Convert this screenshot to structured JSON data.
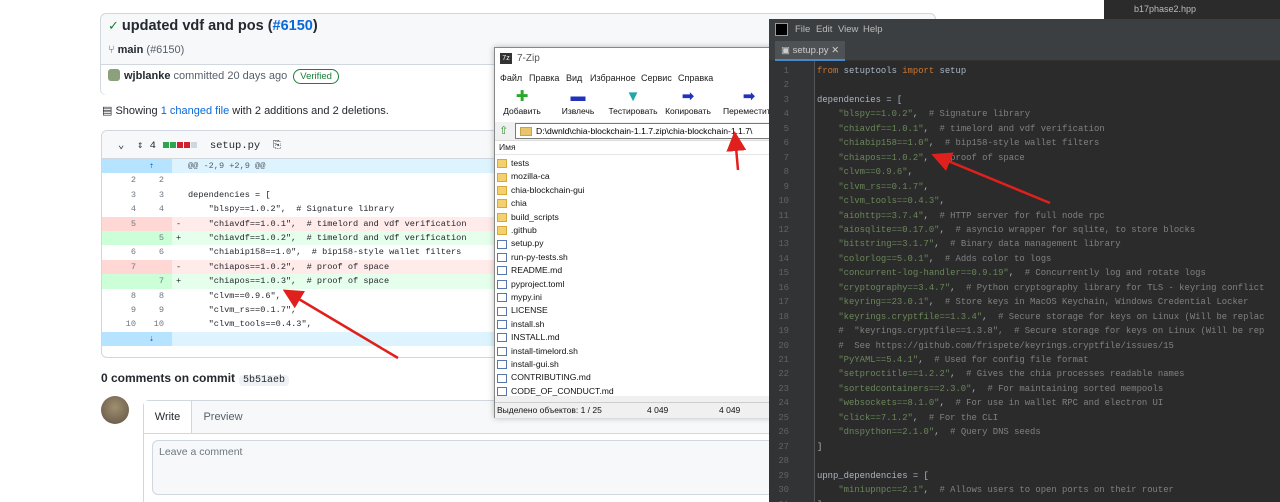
{
  "github": {
    "commit_title": "updated vdf and pos (",
    "commit_pr": "#6150",
    "commit_close": ")",
    "branch": "main",
    "branch_pr": "(#6150)",
    "author": "wjblanke",
    "committed": "committed 20 days ago",
    "verified": "Verified",
    "showing_pre": "Showing ",
    "showing_link": "1 changed file",
    "showing_post": " with 2 additions and 2 deletions.",
    "file_changes": "4",
    "file_name": "setup.py",
    "hunk": "@@ -2,9 +2,9 @@",
    "diff_rows": [
      {
        "type": "hunk",
        "old": "",
        "new": "",
        "sign": "",
        "code": "@@ -2,9 +2,9 @@"
      },
      {
        "type": "ctx",
        "old": "2",
        "new": "2",
        "sign": "",
        "code": ""
      },
      {
        "type": "ctx",
        "old": "3",
        "new": "3",
        "sign": "",
        "code": "dependencies = ["
      },
      {
        "type": "ctx",
        "old": "4",
        "new": "4",
        "sign": "",
        "code": "    \"blspy==1.0.2\",  # Signature library"
      },
      {
        "type": "del",
        "old": "5",
        "new": "",
        "sign": "-",
        "code": "    \"chiavdf==1.0.1\",  # timelord and vdf verification"
      },
      {
        "type": "add",
        "old": "",
        "new": "5",
        "sign": "+",
        "code": "    \"chiavdf==1.0.2\",  # timelord and vdf verification"
      },
      {
        "type": "ctx",
        "old": "6",
        "new": "6",
        "sign": "",
        "code": "    \"chiabip158==1.0\",  # bip158-style wallet filters"
      },
      {
        "type": "del",
        "old": "7",
        "new": "",
        "sign": "-",
        "code": "    \"chiapos==1.0.2\",  # proof of space"
      },
      {
        "type": "add",
        "old": "",
        "new": "7",
        "sign": "+",
        "code": "    \"chiapos==1.0.3\",  # proof of space"
      },
      {
        "type": "ctx",
        "old": "8",
        "new": "8",
        "sign": "",
        "code": "    \"clvm==0.9.6\","
      },
      {
        "type": "ctx",
        "old": "9",
        "new": "9",
        "sign": "",
        "code": "    \"clvm_rs==0.1.7\","
      },
      {
        "type": "ctx",
        "old": "10",
        "new": "10",
        "sign": "",
        "code": "    \"clvm_tools==0.4.3\","
      },
      {
        "type": "hunk",
        "old": "",
        "new": "",
        "sign": "",
        "code": ""
      }
    ],
    "comments": "0 comments on commit",
    "comments_sha": "5b51aeb",
    "tab_write": "Write",
    "tab_preview": "Preview",
    "comment_placeholder": "Leave a comment"
  },
  "zip": {
    "title": "7-Zip",
    "menu": [
      "Файл",
      "Правка",
      "Вид",
      "Избранное",
      "Сервис",
      "Справка"
    ],
    "tools": [
      {
        "label": "Добавить",
        "glyph": "✚",
        "color": "#2aa82a"
      },
      {
        "label": "Извлечь",
        "glyph": "▬",
        "color": "#2233bb"
      },
      {
        "label": "Тестировать",
        "glyph": "▼",
        "color": "#20a8a8"
      },
      {
        "label": "Копировать",
        "glyph": "➡",
        "color": "#2233bb"
      },
      {
        "label": "Переместить",
        "glyph": "➡",
        "color": "#2233bb"
      }
    ],
    "path": "D:\\dwnld\\chia-blockchain-1.1.7.zip\\chia-blockchain-1.1.7\\",
    "column_name": "Имя",
    "items": [
      {
        "name": "tests",
        "kind": "dir"
      },
      {
        "name": "mozilla-ca",
        "kind": "dir"
      },
      {
        "name": "chia-blockchain-gui",
        "kind": "dir"
      },
      {
        "name": "chia",
        "kind": "dir"
      },
      {
        "name": "build_scripts",
        "kind": "dir"
      },
      {
        "name": ".github",
        "kind": "dir"
      },
      {
        "name": "setup.py",
        "kind": "doc"
      },
      {
        "name": "run-py-tests.sh",
        "kind": "doc"
      },
      {
        "name": "README.md",
        "kind": "doc"
      },
      {
        "name": "pyproject.toml",
        "kind": "doc"
      },
      {
        "name": "mypy.ini",
        "kind": "doc"
      },
      {
        "name": "LICENSE",
        "kind": "doc"
      },
      {
        "name": "install.sh",
        "kind": "doc"
      },
      {
        "name": "INSTALL.md",
        "kind": "doc"
      },
      {
        "name": "install-timelord.sh",
        "kind": "doc"
      },
      {
        "name": "install-gui.sh",
        "kind": "doc"
      },
      {
        "name": "CONTRIBUTING.md",
        "kind": "doc"
      },
      {
        "name": "CODE_OF_CONDUCT.md",
        "kind": "doc"
      }
    ],
    "status_selected": "Выделено объектов: 1 / 25",
    "status_size1": "4 049",
    "status_size2": "4 049"
  },
  "ide": {
    "menu": [
      "File",
      "Edit",
      "View",
      "Help"
    ],
    "tab": "setup.py",
    "strip_file": "b17phase2.hpp",
    "lines": [
      {
        "n": "1",
        "html": "<span class='kw'>from</span> setuptools <span class='kw'>import</span> setup"
      },
      {
        "n": "2",
        "html": ""
      },
      {
        "n": "3",
        "html": "dependencies = ["
      },
      {
        "n": "4",
        "html": "    <span class='st'>\"blspy==1.0.2\"</span>,  <span class='cmt'># Signature library</span>"
      },
      {
        "n": "5",
        "html": "    <span class='st'>\"chiavdf==1.0.1\"</span>,  <span class='cmt'># timelord and vdf verification</span>"
      },
      {
        "n": "6",
        "html": "    <span class='st'>\"chiabip158==1.0\"</span>,  <span class='cmt'># bip158-style wallet filters</span>"
      },
      {
        "n": "7",
        "html": "    <span class='st'>\"chiapos==1.0.2\"</span>,  <span class='cmt'># proof of space</span>"
      },
      {
        "n": "8",
        "html": "    <span class='st'>\"clvm==0.9.6\"</span>,"
      },
      {
        "n": "9",
        "html": "    <span class='st'>\"clvm_rs==0.1.7\"</span>,"
      },
      {
        "n": "10",
        "html": "    <span class='st'>\"clvm_tools==0.4.3\"</span>,"
      },
      {
        "n": "11",
        "html": "    <span class='st'>\"aiohttp==3.7.4\"</span>,  <span class='cmt'># HTTP server for full node rpc</span>"
      },
      {
        "n": "12",
        "html": "    <span class='st'>\"aiosqlite==0.17.0\"</span>,  <span class='cmt'># asyncio wrapper for sqlite, to store blocks</span>"
      },
      {
        "n": "13",
        "html": "    <span class='st'>\"bitstring==3.1.7\"</span>,  <span class='cmt'># Binary data management library</span>"
      },
      {
        "n": "14",
        "html": "    <span class='st'>\"colorlog==5.0.1\"</span>,  <span class='cmt'># Adds color to logs</span>"
      },
      {
        "n": "15",
        "html": "    <span class='st'>\"concurrent-log-handler==0.9.19\"</span>,  <span class='cmt'># Concurrently log and rotate logs</span>"
      },
      {
        "n": "16",
        "html": "    <span class='st'>\"cryptography==3.4.7\"</span>,  <span class='cmt'># Python cryptography library for TLS - keyring conflict</span>"
      },
      {
        "n": "17",
        "html": "    <span class='st'>\"keyring==23.0.1\"</span>,  <span class='cmt'># Store keys in MacOS Keychain, Windows Credential Locker</span>"
      },
      {
        "n": "18",
        "html": "    <span class='st'>\"keyrings.cryptfile==1.3.4\"</span>,  <span class='cmt'># Secure storage for keys on Linux (Will be replac</span>"
      },
      {
        "n": "19",
        "html": "    <span class='cmt'>#  \"keyrings.cryptfile==1.3.8\",  # Secure storage for keys on Linux (Will be rep</span>"
      },
      {
        "n": "20",
        "html": "    <span class='cmt'>#  See https://github.com/frispete/keyrings.cryptfile/issues/15</span>"
      },
      {
        "n": "21",
        "html": "    <span class='st'>\"PyYAML==5.4.1\"</span>,  <span class='cmt'># Used for config file format</span>"
      },
      {
        "n": "22",
        "html": "    <span class='st'>\"setproctitle==1.2.2\"</span>,  <span class='cmt'># Gives the chia processes readable names</span>"
      },
      {
        "n": "23",
        "html": "    <span class='st'>\"sortedcontainers==2.3.0\"</span>,  <span class='cmt'># For maintaining sorted mempools</span>"
      },
      {
        "n": "24",
        "html": "    <span class='st'>\"websockets==8.1.0\"</span>,  <span class='cmt'># For use in wallet RPC and electron UI</span>"
      },
      {
        "n": "25",
        "html": "    <span class='st'>\"click==7.1.2\"</span>,  <span class='cmt'># For the CLI</span>"
      },
      {
        "n": "26",
        "html": "    <span class='st'>\"dnspython==2.1.0\"</span>,  <span class='cmt'># Query DNS seeds</span>"
      },
      {
        "n": "27",
        "html": "]"
      },
      {
        "n": "28",
        "html": ""
      },
      {
        "n": "29",
        "html": "upnp_dependencies = ["
      },
      {
        "n": "30",
        "html": "    <span class='st'>\"miniupnpc==2.1\"</span>,  <span class='cmt'># Allows users to open ports on their router</span>"
      },
      {
        "n": "31",
        "html": "]"
      }
    ]
  },
  "colors": {
    "gh_add": "#e6ffec",
    "gh_del": "#ffebe9",
    "ide_bg": "#2b2b2b",
    "arrow": "#e0201c"
  }
}
